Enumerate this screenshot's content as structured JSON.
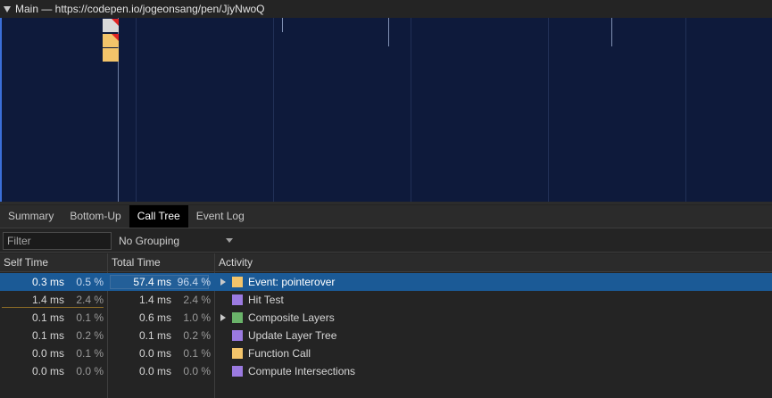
{
  "timeline": {
    "track_title": "Main — https://codepen.io/jogeonsang/pen/JjyNwoQ"
  },
  "tabs": [
    {
      "label": "Summary",
      "active": false
    },
    {
      "label": "Bottom-Up",
      "active": false
    },
    {
      "label": "Call Tree",
      "active": true
    },
    {
      "label": "Event Log",
      "active": false
    }
  ],
  "filter": {
    "placeholder": "Filter",
    "grouping": "No Grouping"
  },
  "table": {
    "headers": {
      "self_time": "Self Time",
      "total_time": "Total Time",
      "activity": "Activity"
    },
    "rows": [
      {
        "self_ms": "0.3 ms",
        "self_pct": "0.5 %",
        "total_ms": "57.4 ms",
        "total_pct": "96.4 %",
        "activity": "Event: pointerover",
        "color": "#f3c46a",
        "expandable": true,
        "selected": true
      },
      {
        "self_ms": "1.4 ms",
        "self_pct": "2.4 %",
        "total_ms": "1.4 ms",
        "total_pct": "2.4 %",
        "activity": "Hit Test",
        "color": "#9b7ae0",
        "expandable": false,
        "selected": false
      },
      {
        "self_ms": "0.1 ms",
        "self_pct": "0.1 %",
        "total_ms": "0.6 ms",
        "total_pct": "1.0 %",
        "activity": "Composite Layers",
        "color": "#6ab36a",
        "expandable": true,
        "selected": false
      },
      {
        "self_ms": "0.1 ms",
        "self_pct": "0.2 %",
        "total_ms": "0.1 ms",
        "total_pct": "0.2 %",
        "activity": "Update Layer Tree",
        "color": "#9b7ae0",
        "expandable": false,
        "selected": false
      },
      {
        "self_ms": "0.0 ms",
        "self_pct": "0.1 %",
        "total_ms": "0.0 ms",
        "total_pct": "0.1 %",
        "activity": "Function Call",
        "color": "#f3c46a",
        "expandable": false,
        "selected": false
      },
      {
        "self_ms": "0.0 ms",
        "self_pct": "0.0 %",
        "total_ms": "0.0 ms",
        "total_pct": "0.0 %",
        "activity": "Compute Intersections",
        "color": "#9b7ae0",
        "expandable": false,
        "selected": false
      }
    ]
  }
}
